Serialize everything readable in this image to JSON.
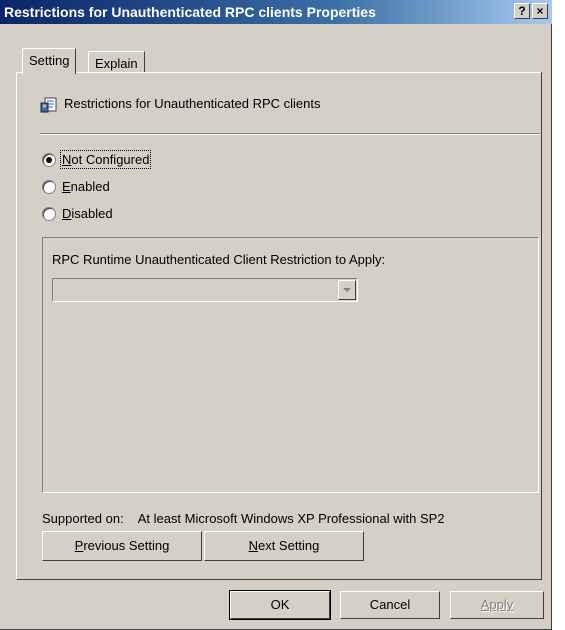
{
  "window": {
    "title": "Restrictions for Unauthenticated RPC clients Properties",
    "help_glyph": "?",
    "close_glyph": "×"
  },
  "tabs": [
    {
      "label": "Setting",
      "active": true
    },
    {
      "label": "Explain",
      "active": false
    }
  ],
  "setting": {
    "policy_name": "Restrictions for Unauthenticated RPC clients",
    "policy_icon": "policy-document-icon",
    "options": [
      {
        "prefix": "",
        "accel": "N",
        "rest": "ot Configured",
        "checked": true
      },
      {
        "prefix": "",
        "accel": "E",
        "rest": "nabled",
        "checked": false
      },
      {
        "prefix": "",
        "accel": "D",
        "rest": "isabled",
        "checked": false
      }
    ],
    "group_label": "RPC Runtime Unauthenticated Client Restriction to Apply:",
    "combo_value": "",
    "supported_label": "Supported on:",
    "supported_value": "At least Microsoft Windows XP Professional with SP2",
    "prev_button": {
      "accel": "P",
      "rest": "revious Setting"
    },
    "next_button": {
      "accel": "N",
      "rest": "ext Setting"
    }
  },
  "footer": {
    "ok": "OK",
    "cancel": "Cancel",
    "apply": "Apply",
    "apply_enabled": false
  },
  "colors": {
    "face": "#d4d0c8",
    "title_start": "#0a246a",
    "title_end": "#a6caf0"
  }
}
